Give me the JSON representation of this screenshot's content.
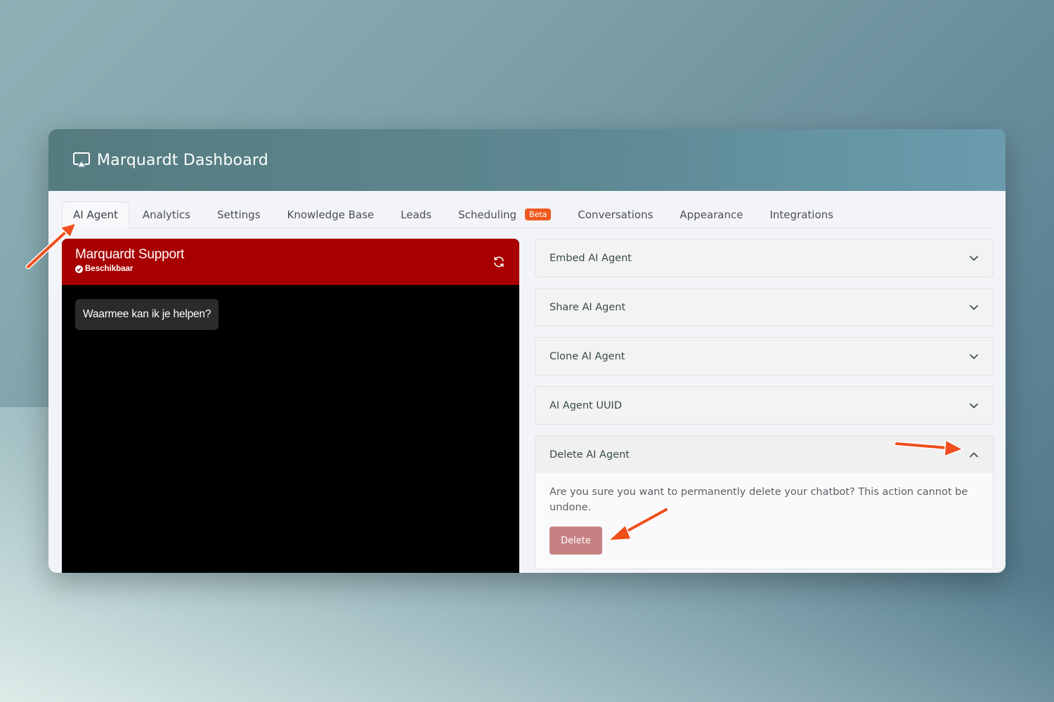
{
  "app": {
    "title": "Marquardt Dashboard",
    "icon": "airplay-monitor-icon"
  },
  "tabs": [
    {
      "label": "AI Agent",
      "active": true
    },
    {
      "label": "Analytics"
    },
    {
      "label": "Settings"
    },
    {
      "label": "Knowledge Base"
    },
    {
      "label": "Leads"
    },
    {
      "label": "Scheduling",
      "badge": "Beta"
    },
    {
      "label": "Conversations"
    },
    {
      "label": "Appearance"
    },
    {
      "label": "Integrations"
    }
  ],
  "chat": {
    "title": "Marquardt Support",
    "status": "Beschikbaar",
    "greeting": "Waarmee kan ik je helpen?",
    "header_color": "#a80000"
  },
  "accordion": [
    {
      "label": "Embed AI Agent",
      "expanded": false
    },
    {
      "label": "Share AI Agent",
      "expanded": false
    },
    {
      "label": "Clone AI Agent",
      "expanded": false
    },
    {
      "label": "AI Agent UUID",
      "expanded": false
    },
    {
      "label": "Delete AI Agent",
      "expanded": true,
      "text": "Are you sure you want to permanently delete your chatbot? This action cannot be undone.",
      "button": "Delete"
    }
  ],
  "colors": {
    "accent_arrow": "#ee4f1c",
    "beta_badge": "#ee5a1f",
    "delete_button": "#c68282"
  }
}
